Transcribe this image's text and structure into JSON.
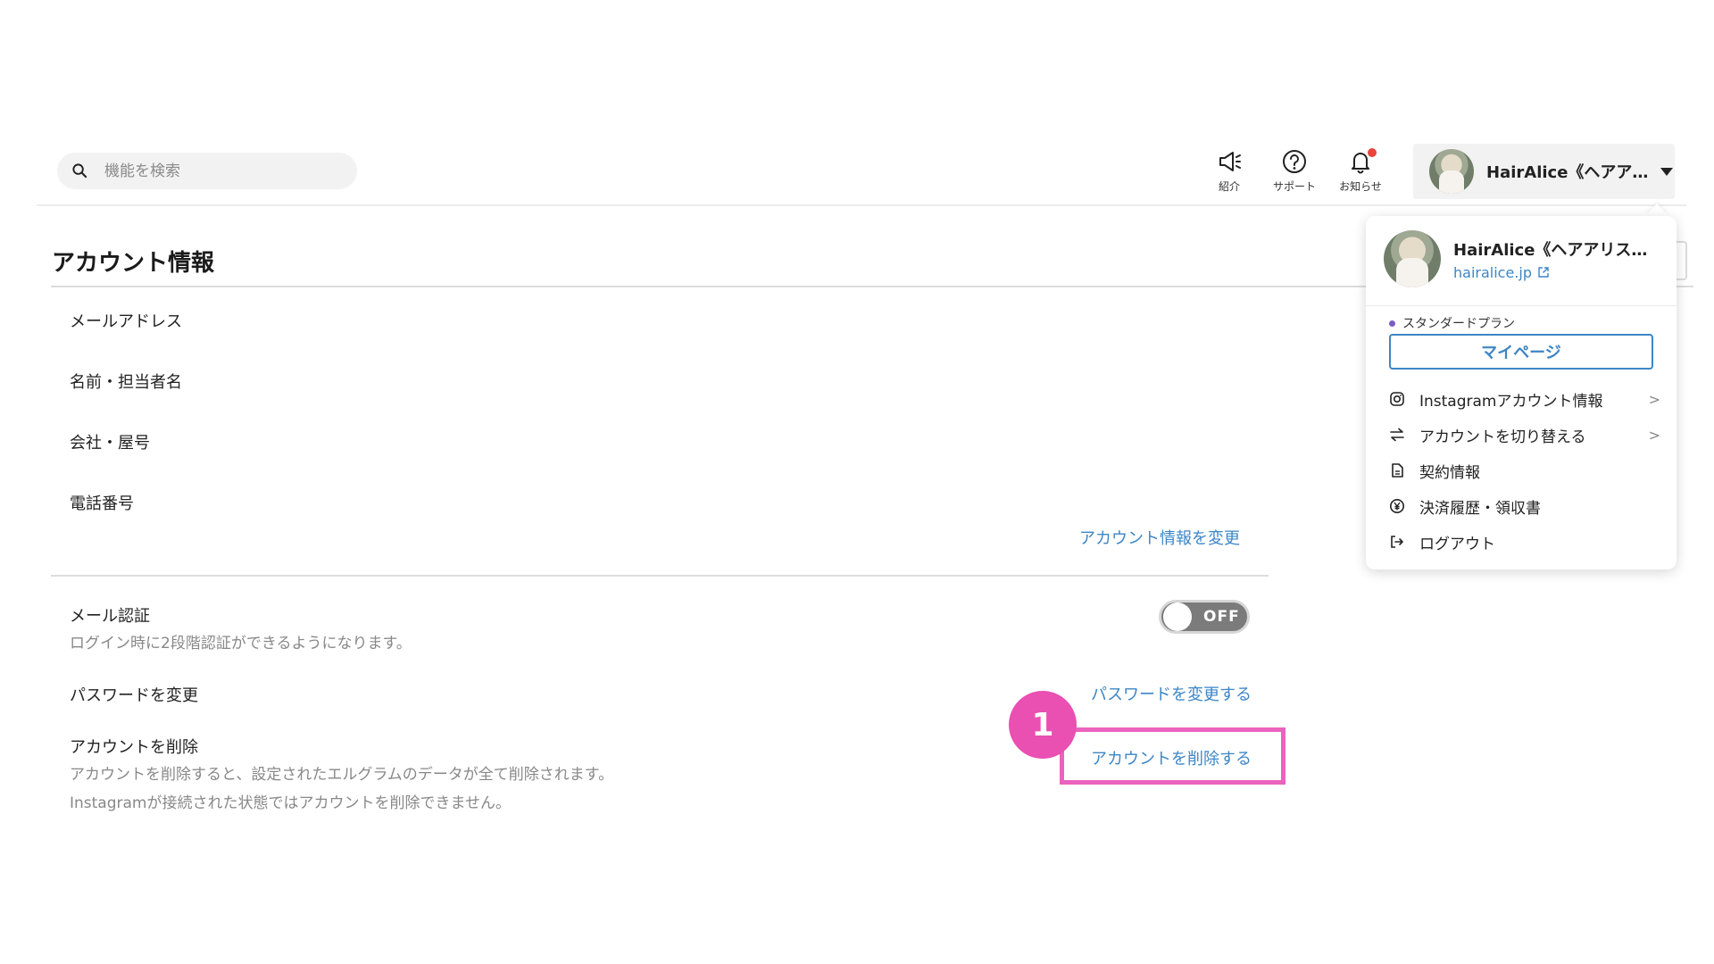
{
  "search": {
    "placeholder": "機能を検索"
  },
  "header": {
    "tools": [
      {
        "label": "紹介",
        "icon": "megaphone-icon"
      },
      {
        "label": "サポート",
        "icon": "help-circle-icon"
      },
      {
        "label": "お知らせ",
        "icon": "bell-icon"
      }
    ],
    "account_name": "HairAlice《ヘアア…"
  },
  "page": {
    "title": "アカウント情報",
    "fields": [
      "メールアドレス",
      "名前・担当者名",
      "会社・屋号",
      "電話番号"
    ],
    "edit_link": "アカウント情報を変更",
    "mail_auth": {
      "title": "メール認証",
      "desc": "ログイン時に2段階認証ができるようになります。",
      "toggle": "OFF"
    },
    "password": {
      "title": "パスワードを変更",
      "link": "パスワードを変更する"
    },
    "delete": {
      "title": "アカウントを削除",
      "desc1": "アカウントを削除すると、設定されたエルグラムのデータが全て削除されます。",
      "desc2": "Instagramが接続された状態ではアカウントを削除できません。",
      "link": "アカウントを削除する"
    }
  },
  "annotation": {
    "number": "1",
    "color": "#ea4fb2"
  },
  "dropdown": {
    "name": "HairAlice《ヘアアリス…",
    "site": "hairalice.jp",
    "plan": "スタンダードプラン",
    "mypage": "マイページ",
    "items": [
      {
        "label": "Instagramアカウント情報",
        "icon": "instagram-icon",
        "chevron": ">"
      },
      {
        "label": "アカウントを切り替える",
        "icon": "switch-arrows-icon",
        "chevron": ">"
      },
      {
        "label": "契約情報",
        "icon": "document-icon"
      },
      {
        "label": "決済履歴・領収書",
        "icon": "yen-icon"
      },
      {
        "label": "ログアウト",
        "icon": "logout-icon"
      }
    ]
  },
  "colors": {
    "link": "#3d86c6",
    "accent_pink": "#ea63bd",
    "plan_dot": "#7a5cc8",
    "notif": "#e8453c"
  }
}
